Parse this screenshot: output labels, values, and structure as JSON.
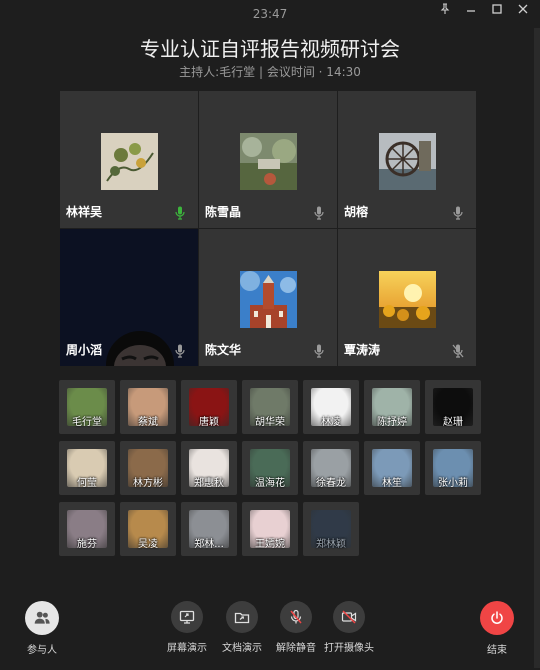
{
  "clock": "23:47",
  "meeting": {
    "title": "专业认证自评报告视频研讨会",
    "host_label": "主持人:毛行堂",
    "separator": "|",
    "time_label": "会议时间 · 14:30"
  },
  "video_tiles": [
    {
      "name": "林祥吴",
      "mic": "speaking",
      "avatar": "painting-avatar"
    },
    {
      "name": "陈雪晶",
      "mic": "on",
      "avatar": "garden-avatar"
    },
    {
      "name": "胡榕",
      "mic": "on",
      "avatar": "waterwheel-avatar"
    },
    {
      "name": "周小滔",
      "mic": "on",
      "avatar": "camera-feed"
    },
    {
      "name": "陈文华",
      "mic": "on",
      "avatar": "building-avatar"
    },
    {
      "name": "覃涛涛",
      "mic": "muted",
      "avatar": "sunflower-avatar"
    }
  ],
  "participants": [
    {
      "name": "毛行堂",
      "color": "#6b8c4a"
    },
    {
      "name": "蔡斌",
      "color": "#c79a7a"
    },
    {
      "name": "唐颖",
      "color": "#8a1414"
    },
    {
      "name": "胡华荣",
      "color": "#6f7a68"
    },
    {
      "name": "林凌",
      "color": "#f2f2f2"
    },
    {
      "name": "陈抒婷",
      "color": "#9fb3a8"
    },
    {
      "name": "赵珊",
      "color": "#0d0d0d"
    },
    {
      "name": "何莹",
      "color": "#d9cbb2"
    },
    {
      "name": "林方彬",
      "color": "#8b6a4a"
    },
    {
      "name": "郑惠秋",
      "color": "#e9e3df"
    },
    {
      "name": "温海花",
      "color": "#4a6b57"
    },
    {
      "name": "徐春龙",
      "color": "#9aa0a4"
    },
    {
      "name": "林笙",
      "color": "#7c9ab8"
    },
    {
      "name": "张小莉",
      "color": "#6c8fb0"
    },
    {
      "name": "施芬",
      "color": "#8a7d86"
    },
    {
      "name": "吴凌",
      "color": "#b78a4c"
    },
    {
      "name": "郑林...",
      "color": "#8c8f94"
    },
    {
      "name": "王嫣婉",
      "color": "#e8d0d2"
    },
    {
      "name": "郑林颖",
      "color": "#2b3f58",
      "dim": true
    }
  ],
  "toolbar": {
    "participants": "参与人",
    "screen_share": "屏幕演示",
    "doc_share": "文档演示",
    "unmute": "解除静音",
    "camera": "打开摄像头",
    "end": "结束"
  },
  "colors": {
    "background": "#1e1e1e",
    "tile": "#343434",
    "speaking": "#3cb53c",
    "end": "#f04545"
  }
}
